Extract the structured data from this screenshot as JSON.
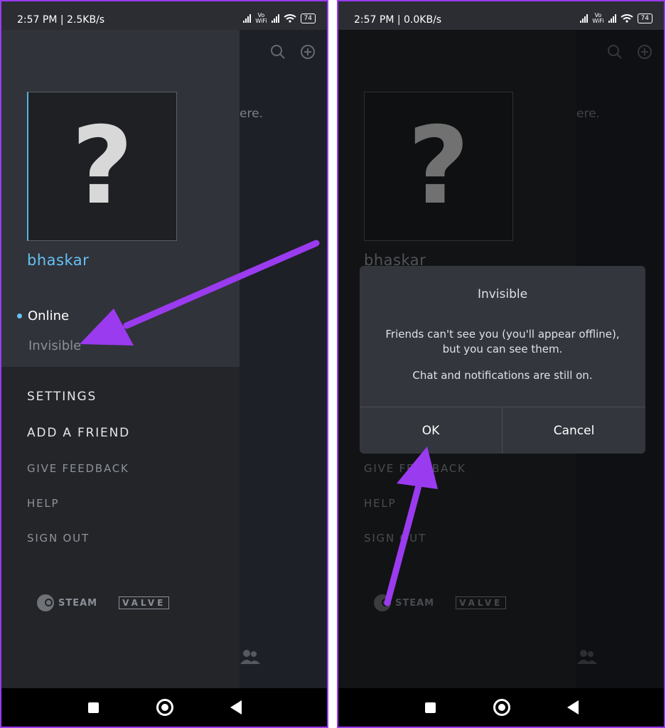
{
  "status_bar": {
    "left_time": "2:57 PM | 2.5KB/s",
    "right_time": "2:57 PM | 0.0KB/s",
    "vowifi": "Vo\nWiFi",
    "battery": "74"
  },
  "background": {
    "partial_text": "ere."
  },
  "profile": {
    "username": "bhaskar",
    "avatar_glyph": "?"
  },
  "status_menu": {
    "online": "Online",
    "invisible": "Invisible"
  },
  "menu": {
    "settings": "SETTINGS",
    "add_friend": "ADD A FRIEND",
    "give_feedback": "GIVE FEEDBACK",
    "help": "HELP",
    "sign_out": "SIGN OUT"
  },
  "brands": {
    "steam": "STEAM",
    "valve": "VALVE"
  },
  "dialog": {
    "title": "Invisible",
    "message_line1": "Friends can't see you (you'll appear offline),",
    "message_line2": "but you can see them.",
    "message2": "Chat and notifications are still on.",
    "ok": "OK",
    "cancel": "Cancel"
  },
  "colors": {
    "accent_blue": "#67c1f5",
    "annotation_purple": "#9b3bf0"
  }
}
